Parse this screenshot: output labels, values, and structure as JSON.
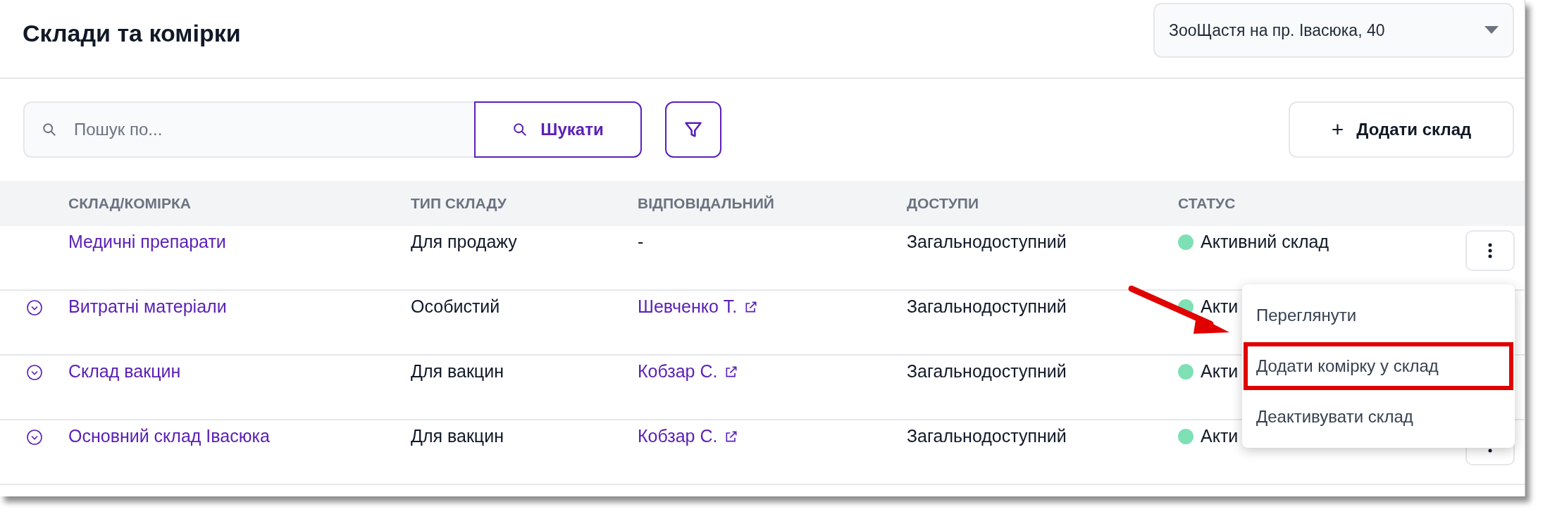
{
  "header": {
    "title": "Склади та комірки",
    "location_select": {
      "value": "ЗооЩастя на пр. Івасюка, 40"
    }
  },
  "toolbar": {
    "search": {
      "placeholder": "Пошук по..."
    },
    "search_button": "Шукати",
    "add_button": {
      "icon": "+",
      "label": "Додати склад"
    }
  },
  "table": {
    "columns": [
      "СКЛАД/КОМІРКА",
      "ТИП СКЛАДУ",
      "ВІДПОВІДАЛЬНИЙ",
      "ДОСТУПИ",
      "СТАТУС"
    ],
    "rows": [
      {
        "expandable": false,
        "name": "Медичні препарати",
        "type": "Для продажу",
        "responsible": {
          "kind": "text",
          "label": "-"
        },
        "access": "Загальнодоступний",
        "status": {
          "label": "Активний склад",
          "color": "#7ee0b5"
        },
        "menu_button": true
      },
      {
        "expandable": true,
        "name": "Витратні матеріали",
        "type": "Особистий",
        "responsible": {
          "kind": "link",
          "label": "Шевченко Т."
        },
        "access": "Загальнодоступний",
        "status": {
          "label": "Акти",
          "color": "#7ee0b5"
        },
        "menu_button": false
      },
      {
        "expandable": true,
        "name": "Склад вакцин",
        "type": "Для вакцин",
        "responsible": {
          "kind": "link",
          "label": "Кобзар С."
        },
        "access": "Загальнодоступний",
        "status": {
          "label": "Акти",
          "color": "#7ee0b5"
        },
        "menu_button": false
      },
      {
        "expandable": true,
        "name": "Основний склад Івасюка",
        "type": "Для вакцин",
        "responsible": {
          "kind": "link",
          "label": "Кобзар С."
        },
        "access": "Загальнодоступний",
        "status": {
          "label": "Акти",
          "color": "#7ee0b5"
        },
        "menu_button": true
      }
    ]
  },
  "row_menu": {
    "items": [
      {
        "label": "Переглянути",
        "highlighted": false
      },
      {
        "label": "Додати комірку у склад",
        "highlighted": true
      },
      {
        "label": "Деактивувати склад",
        "highlighted": false
      }
    ]
  }
}
